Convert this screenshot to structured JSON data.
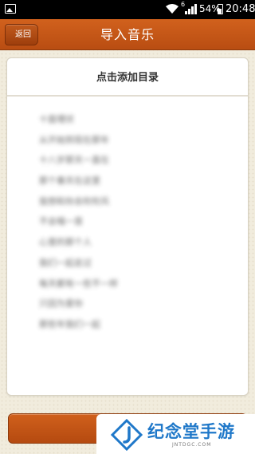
{
  "status_bar": {
    "network_type": "6",
    "battery": "54%",
    "time": "20:48"
  },
  "header": {
    "back_label": "返回",
    "title": "导入音乐",
    "color": "#c4561a"
  },
  "content": {
    "add_directory_label": "点击添加目录",
    "songs": [
      "十面埋伏",
      "从开始到现在那年",
      "十八岁那天一直在",
      "那个春天在这里",
      "我想和你去吹吹风",
      "不会唱一首",
      "心里的那个人",
      "我们一起走过",
      "每天都有一些不一样",
      "只因为爱你",
      "那些年我们一起"
    ]
  },
  "watermark": {
    "text": "纪念堂手游",
    "subtext": "JNTDGC.COM",
    "color": "#1f78c9"
  }
}
